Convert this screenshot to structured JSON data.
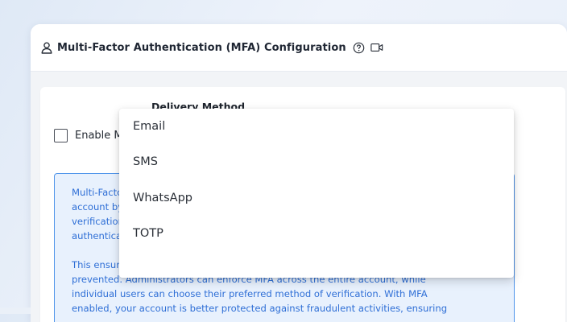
{
  "header": {
    "title": "Multi-Factor Authentication (MFA) Configuration",
    "icons": [
      "user-icon",
      "help-icon",
      "video-icon"
    ]
  },
  "form": {
    "enable_label": "Enable MFA",
    "enable_checked": false,
    "delivery_label": "Delivery Method",
    "delivery_value": ""
  },
  "info": {
    "p1_lines": [
      "Multi-Factor Au",
      "account by req",
      "verification, suc",
      "authenticator c"
    ],
    "p2_lines": [
      "This ensures th",
      "prevented. Administrators can enforce MFA across the entire account, while",
      "individual users can choose their preferred method of verification. With MFA",
      "enabled, your account is better protected against fraudulent activities, ensuring"
    ]
  },
  "dropdown": {
    "options": [
      "Email",
      "SMS",
      "WhatsApp",
      "TOTP"
    ]
  },
  "colors": {
    "accent": "#1aa39a",
    "info_text": "#2f6fd6",
    "info_border": "#4f94ea",
    "info_bg": "#e8f1fd"
  }
}
